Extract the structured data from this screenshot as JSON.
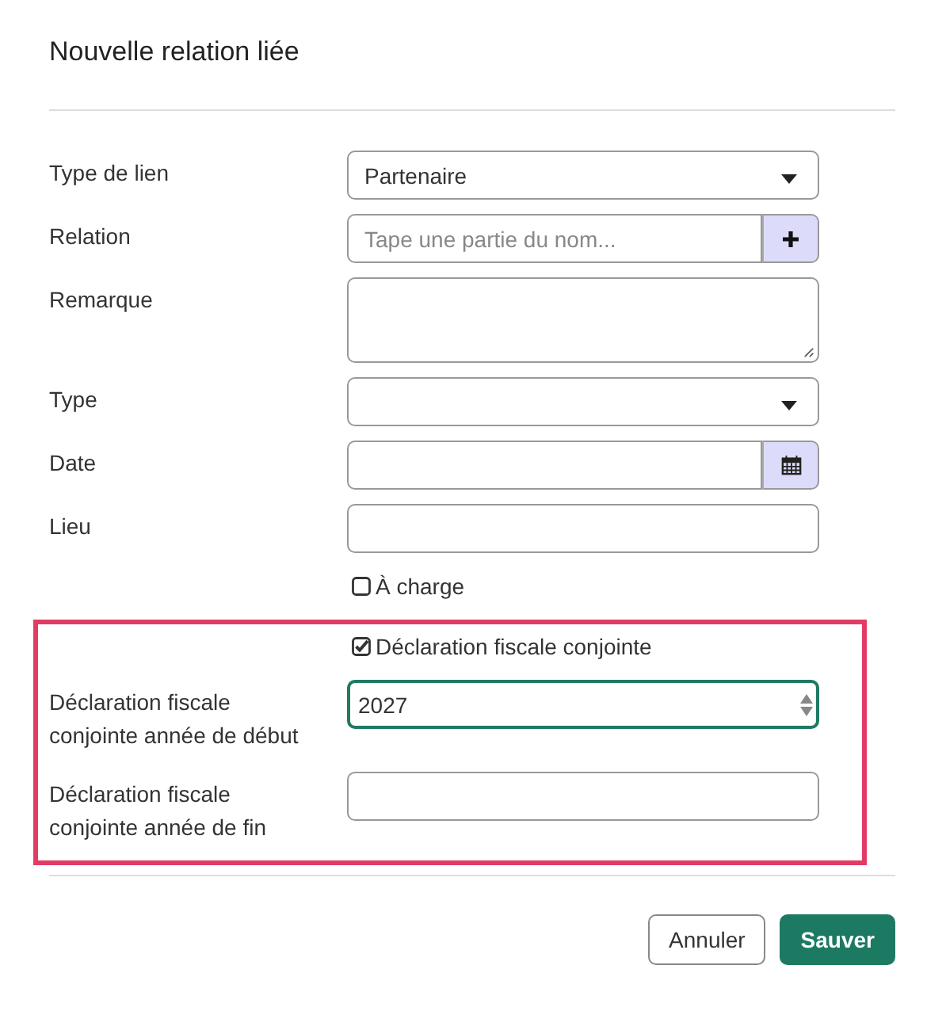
{
  "title": "Nouvelle relation liée",
  "fields": [
    {
      "kind": "select",
      "label": "Type de lien",
      "value": "Partenaire"
    },
    {
      "kind": "lookup",
      "label": "Relation",
      "placeholder": "Tape une partie du nom..."
    },
    {
      "kind": "textarea",
      "label": "Remarque"
    },
    {
      "kind": "select",
      "label": "Type"
    },
    {
      "kind": "date",
      "label": "Date"
    },
    {
      "kind": "text",
      "label": "Lieu"
    },
    {
      "kind": "checkbox",
      "label": "À charge",
      "checked": false
    }
  ],
  "highlighted_fields": [
    {
      "kind": "checkbox",
      "label": "Déclaration fiscale conjointe",
      "checked": true
    },
    {
      "kind": "number",
      "label": "Déclaration fiscale conjointe année de début",
      "value": "2027",
      "focused": true
    },
    {
      "kind": "text",
      "label": "Déclaration fiscale conjointe année de fin"
    }
  ],
  "buttons": [
    {
      "label": "Annuler",
      "kind": "secondary"
    },
    {
      "label": "Sauver",
      "kind": "primary"
    }
  ]
}
